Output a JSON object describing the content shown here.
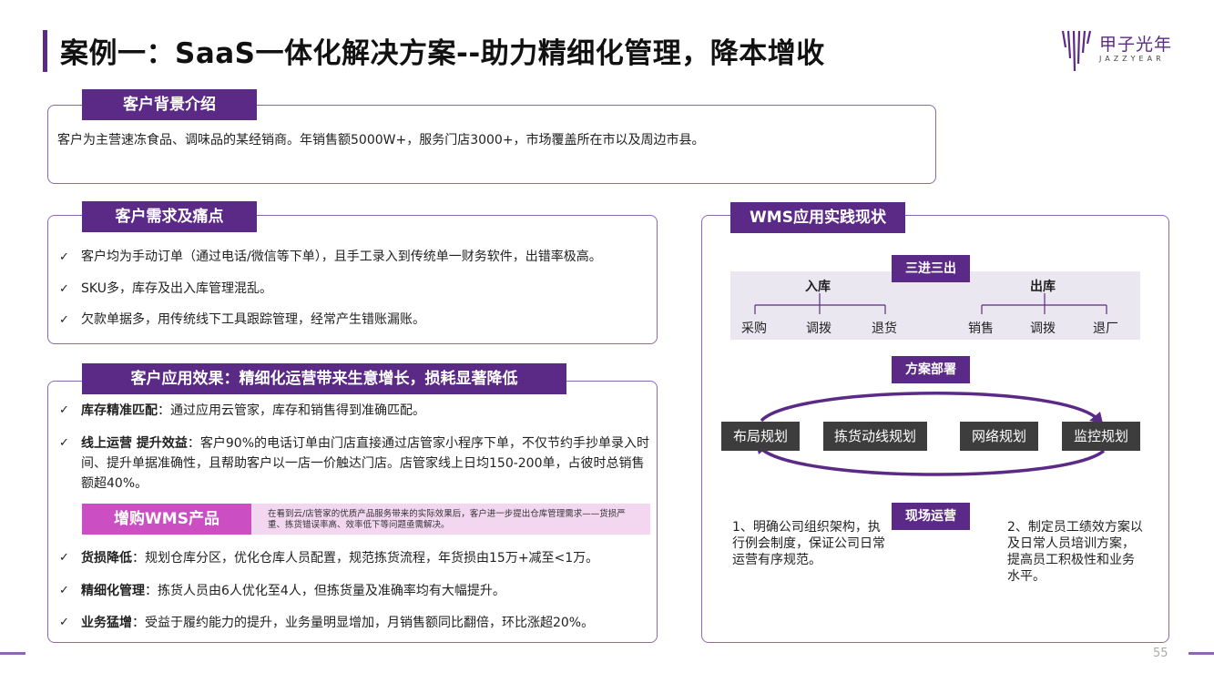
{
  "title": "案例一：SaaS一体化解决方案--助力精细化管理，降本增收",
  "logo": {
    "cn": "甲子光年",
    "en": "JAZZYEAR"
  },
  "background": {
    "tag": "客户背景介绍",
    "text": "客户为主营速冻食品、调味品的某经销商。年销售额5000W+，服务门店3000+，市场覆盖所在市以及周边市县。"
  },
  "pain": {
    "tag": "客户需求及痛点",
    "items": [
      "客户均为手动订单（通过电话/微信等下单），且手工录入到传统单一财务软件，出错率极高。",
      "SKU多，库存及出入库管理混乱。",
      "欠款单据多，用传统线下工具跟踪管理，经常产生错账漏账。"
    ]
  },
  "effect": {
    "tag": "客户应用效果：精细化运营带来生意增长，损耗显著降低",
    "items": [
      {
        "bold": "库存精准匹配",
        "text": "：通过应用云管家，库存和销售得到准确匹配。"
      },
      {
        "bold": "线上运营 提升效益",
        "text": "：客户90%的电话订单由门店直接通过店管家小程序下单，不仅节约手抄单录入时间、提升单据准确性，且帮助客户以一店一价触达门店。店管家线上日均150-200单，占彼时总销售额超40%。"
      },
      {
        "bold": "货损降低",
        "text": "：规划仓库分区，优化仓库人员配置，规范拣货流程，年货损由15万+减至<1万。"
      },
      {
        "bold": "精细化管理",
        "text": "：拣货人员由6人优化至4人，但拣货量及准确率均有大幅提升。"
      },
      {
        "bold": "业务猛增",
        "text": "：受益于履约能力的提升，业务量明显增加，月销售额同比翻倍，环比涨超20%。"
      }
    ],
    "wms_tag": "增购WMS产品",
    "wms_note": "在看到云/店管家的优质产品服务带来的实际效果后，客户进一步提出仓库管理需求——货损严重、拣货错误率高、效率低下等问题亟需解决。"
  },
  "wms": {
    "tag": "WMS应用实践现状",
    "flow_tag": "三进三出",
    "in_label": "入库",
    "in_items": [
      "采购",
      "调拨",
      "退货"
    ],
    "out_label": "出库",
    "out_items": [
      "销售",
      "调拨",
      "退厂"
    ],
    "deploy_tag": "方案部署",
    "deploy_items": [
      "布局规划",
      "拣货动线规划",
      "网络规划",
      "监控规划"
    ],
    "ops_tag": "现场运营",
    "ops_left": "1、明确公司组织架构，执行例会制度，保证公司日常运营有序规范。",
    "ops_right": "2、制定员工绩效方案以及日常人员培训方案，提高员工积极性和业务水平。"
  },
  "page_number": "55",
  "colors": {
    "primary": "#5b2a86",
    "wms_tag": "#cb4fc2",
    "wms_bg": "#f3d6ef",
    "border": "#8d67b4",
    "dark_box": "#3d3d3d"
  },
  "check_icon": "✓"
}
